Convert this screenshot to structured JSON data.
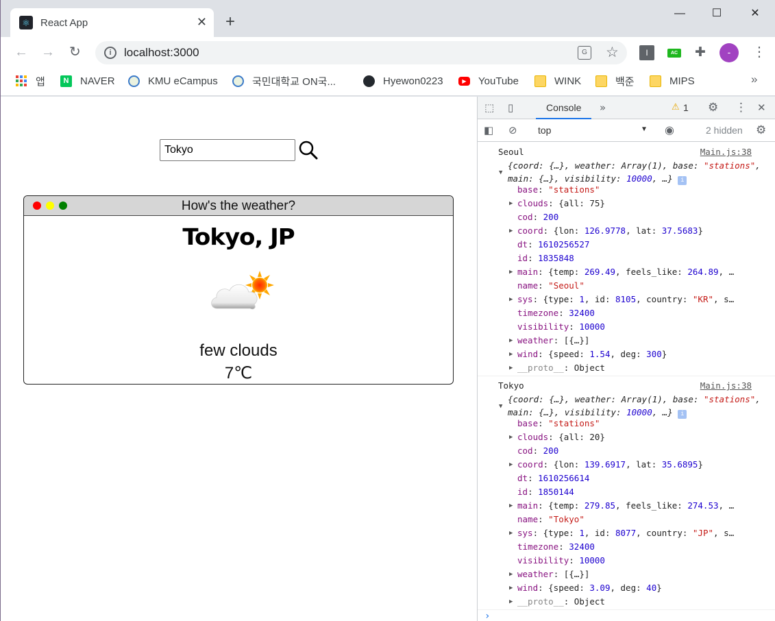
{
  "browser": {
    "tab_title": "React App",
    "new_tab": "+",
    "url": "localhost:3000",
    "avatar_letter": "-",
    "ext_i": "I",
    "ext_ac": "AC"
  },
  "bookmarks": [
    {
      "label": "앱",
      "icon": "apps-icon"
    },
    {
      "label": "NAVER",
      "icon": "naver-icon"
    },
    {
      "label": "KMU eCampus",
      "icon": "kmu-icon"
    },
    {
      "label": "국민대학교 ON국...",
      "icon": "kmu-icon"
    },
    {
      "label": "Hyewon0223",
      "icon": "github-icon"
    },
    {
      "label": "YouTube",
      "icon": "youtube-icon"
    },
    {
      "label": "WINK",
      "icon": "folder-icon"
    },
    {
      "label": "백준",
      "icon": "folder-icon"
    },
    {
      "label": "MIPS",
      "icon": "folder-icon"
    }
  ],
  "bookmarks_more": "»",
  "app": {
    "search_value": "Tokyo",
    "card_title": "How's the weather?",
    "city": "Tokyo, JP",
    "description": "few clouds",
    "temperature": "7℃"
  },
  "devtools": {
    "tab": "Console",
    "more_tabs": "»",
    "warnings": "1",
    "context": "top",
    "hidden": "2 hidden",
    "logs": [
      {
        "label": "Seoul",
        "source": "Main.js:38",
        "summary_a": "{coord: {…}, weather: Array(1), base: ",
        "summary_a_str": "\"stati",
        "summary_b_str": "ons\"",
        "summary_b": ", main: {…}, visibility: ",
        "summary_b_num": "10000",
        "summary_b_end": ", …}",
        "base": "\"stations\"",
        "clouds": "{all: 75}",
        "cod": "200",
        "coord_lon": "126.9778",
        "coord_lat": "37.5683",
        "dt": "1610256527",
        "id": "1835848",
        "main_temp": "269.49",
        "main_feels": "264.89",
        "name": "\"Seoul\"",
        "sys_id": "8105",
        "sys_country": "\"KR\"",
        "timezone": "32400",
        "visibility": "10000",
        "weather": "[{…}]",
        "wind_speed": "1.54",
        "wind_deg": "300",
        "proto": "Object"
      },
      {
        "label": "Tokyo",
        "source": "Main.js:38",
        "summary_a": "{coord: {…}, weather: Array(1), base: ",
        "summary_a_str": "\"stati",
        "summary_b_str": "ons\"",
        "summary_b": ", main: {…}, visibility: ",
        "summary_b_num": "10000",
        "summary_b_end": ", …}",
        "base": "\"stations\"",
        "clouds": "{all: 20}",
        "cod": "200",
        "coord_lon": "139.6917",
        "coord_lat": "35.6895",
        "dt": "1610256614",
        "id": "1850144",
        "main_temp": "279.85",
        "main_feels": "274.53",
        "name": "\"Tokyo\"",
        "sys_id": "8077",
        "sys_country": "\"JP\"",
        "timezone": "32400",
        "visibility": "10000",
        "weather": "[{…}]",
        "wind_speed": "3.09",
        "wind_deg": "40",
        "proto": "Object"
      }
    ]
  },
  "colors": {
    "dot_red": "#ff0000",
    "dot_yellow": "#ffff00",
    "dot_green": "#008000",
    "profile": "#a142c1"
  }
}
